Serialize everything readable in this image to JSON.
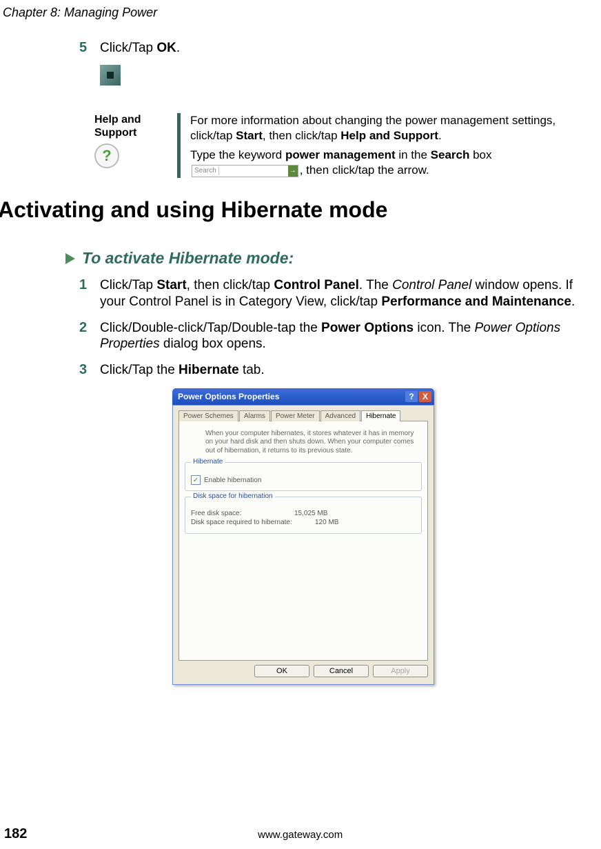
{
  "chapter": "Chapter 8: Managing Power",
  "step5": {
    "num": "5",
    "pre": "Click/Tap ",
    "bold": "OK",
    "post": "."
  },
  "help": {
    "label": "Help and Support",
    "q": "?",
    "p1_a": "For more information about changing the power management settings, click/tap ",
    "p1_b": "Start",
    "p1_c": ", then click/tap ",
    "p1_d": "Help and Support",
    "p1_e": ".",
    "p2_a": "Type the keyword ",
    "p2_b": "power management",
    "p2_c": " in the ",
    "p2_d": "Search",
    "p2_e": " box ",
    "p2_f": ", then click/tap the arrow.",
    "search_label": "Search",
    "arrow": "→"
  },
  "h2": "Activating and using Hibernate mode",
  "subhead": "To activate Hibernate mode:",
  "steps": {
    "s1": {
      "num": "1",
      "a": "Click/Tap ",
      "b": "Start",
      "c": ", then click/tap ",
      "d": "Control Panel",
      "e": ". The ",
      "f": "Control Panel",
      "g": " window opens. If your Control Panel is in Category View, click/tap ",
      "h": "Performance and Maintenance",
      "i": "."
    },
    "s2": {
      "num": "2",
      "a": "Click/Double-click/Tap/Double-tap the ",
      "b": "Power Options",
      "c": " icon. The ",
      "d": "Power Options Properties",
      "e": " dialog box opens."
    },
    "s3": {
      "num": "3",
      "a": "Click/Tap the ",
      "b": "Hibernate",
      "c": " tab."
    }
  },
  "dialog": {
    "title": "Power Options Properties",
    "help_btn": "?",
    "close_btn": "X",
    "tabs": {
      "t1": "Power Schemes",
      "t2": "Alarms",
      "t3": "Power Meter",
      "t4": "Advanced",
      "t5": "Hibernate"
    },
    "desc": "When your computer hibernates, it stores whatever it has in memory on your hard disk and then shuts down. When your computer comes out of hibernation, it returns to its previous state.",
    "g1": {
      "title": "Hibernate",
      "check": "✓",
      "label": "Enable hibernation"
    },
    "g2": {
      "title": "Disk space for hibernation",
      "r1l": "Free disk space:",
      "r1v": "15,025 MB",
      "r2l": "Disk space required to hibernate:",
      "r2v": "120 MB"
    },
    "ok": "OK",
    "cancel": "Cancel",
    "apply": "Apply"
  },
  "footer": {
    "page": "182",
    "url": "www.gateway.com"
  }
}
